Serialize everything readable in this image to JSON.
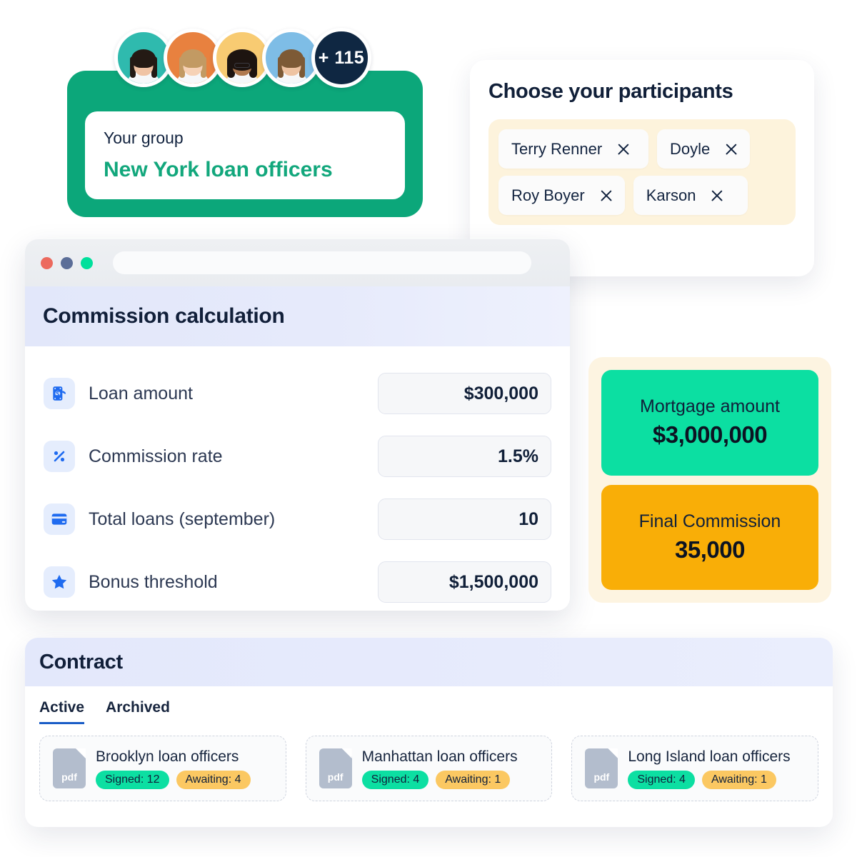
{
  "group": {
    "label": "Your group",
    "name": "New York loan officers",
    "more_count": "+ 115",
    "accent_color": "#0CA77A",
    "name_color": "#12A77C",
    "avatars": [
      {
        "name": "avatar-1",
        "bg": "#2FBAAE",
        "hair": "#241a14",
        "skin": "#f0c3a4",
        "glasses": false
      },
      {
        "name": "avatar-2",
        "bg": "#E8813F",
        "hair": "#c29a63",
        "skin": "#f6d2b6",
        "glasses": false
      },
      {
        "name": "avatar-3",
        "bg": "#F8CB72",
        "hair": "#1d1410",
        "skin": "#b0794f",
        "glasses": true
      },
      {
        "name": "avatar-4",
        "bg": "#7EBDE6",
        "hair": "#7d5a36",
        "skin": "#eec3a2",
        "glasses": false
      }
    ]
  },
  "participants": {
    "title": "Choose your participants",
    "box_color": "#FDF3DC",
    "chips": [
      {
        "label": "Terry Renner",
        "remove_icon": "close-icon"
      },
      {
        "label": "Doyle",
        "remove_icon": "close-icon"
      },
      {
        "label": "Roy Boyer",
        "remove_icon": "close-icon"
      },
      {
        "label": "Karson",
        "remove_icon": "close-icon"
      }
    ]
  },
  "browser": {
    "traffic_lights": [
      {
        "name": "close-dot",
        "color": "#EC6A5E"
      },
      {
        "name": "minimize-dot",
        "color": "#5B6E98"
      },
      {
        "name": "maximize-dot",
        "color": "#00E09C"
      }
    ],
    "url_value": ""
  },
  "calculator": {
    "title": "Commission calculation",
    "rows": [
      {
        "icon": "money-hand-icon",
        "label": "Loan amount",
        "value": "$300,000"
      },
      {
        "icon": "percent-icon",
        "label": "Commission rate",
        "value": "1.5%"
      },
      {
        "icon": "credit-card-icon",
        "label": "Total loans (september)",
        "value": "10"
      },
      {
        "icon": "star-icon",
        "label": "Bonus threshold",
        "value": "$1,500,000"
      }
    ]
  },
  "results": {
    "card_bg": "#FDF4E1",
    "tiles": [
      {
        "label": "Mortgage amount",
        "value": "$3,000,000",
        "color": "#0CDFA2"
      },
      {
        "label": "Final Commission",
        "value": "35,000",
        "color": "#F9AE07"
      }
    ]
  },
  "contract": {
    "title": "Contract",
    "tabs": [
      {
        "label": "Active",
        "active": true
      },
      {
        "label": "Archived",
        "active": false
      }
    ],
    "active_tab_color": "#1A5DC7",
    "cards": [
      {
        "file_icon": "pdf-file-icon",
        "name": "Brooklyn loan officers",
        "signed": "Signed: 12",
        "awaiting": "Awaiting: 4"
      },
      {
        "file_icon": "pdf-file-icon",
        "name": "Manhattan loan officers",
        "signed": "Signed: 4",
        "awaiting": "Awaiting: 1"
      },
      {
        "file_icon": "pdf-file-icon",
        "name": "Long Island loan officers",
        "signed": "Signed: 4",
        "awaiting": "Awaiting: 1"
      }
    ],
    "badge_signed_color": "#0CDFA2",
    "badge_awaiting_color": "#FBC862"
  }
}
